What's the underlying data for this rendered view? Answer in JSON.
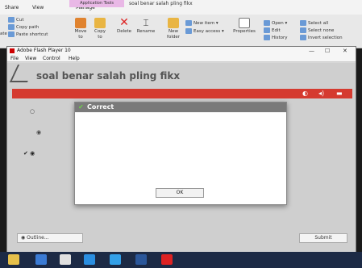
{
  "ribbon": {
    "tabs": [
      "Share",
      "View",
      "Manage"
    ],
    "app_tools_label": "Application Tools",
    "window_title": "soal benar salah pling fikx",
    "cut": "Cut",
    "copy_path": "Copy path",
    "paste_shortcut": "Paste shortcut",
    "paste_partial": "ate",
    "move_to": "Move to",
    "copy_to": "Copy to",
    "delete": "Delete",
    "rename": "Rename",
    "new_folder": "New folder",
    "new_item": "New item",
    "easy_access": "Easy access",
    "properties": "Properties",
    "open": "Open",
    "edit": "Edit",
    "history": "History",
    "select_all": "Select all",
    "select_none": "Select none",
    "invert_selection": "Invert selection"
  },
  "flash": {
    "title": "Adobe Flash Player 10",
    "menu": [
      "File",
      "View",
      "Control",
      "Help"
    ],
    "quiz_title": "soal benar salah pling fikx",
    "outline_label": "Outline...",
    "submit_label": "Submit"
  },
  "dialog": {
    "title": "Correct",
    "ok_label": "OK"
  },
  "colors": {
    "accent_red": "#d53a2f",
    "dialog_header": "#7a7a7a",
    "taskbar": "#1c2a45"
  }
}
